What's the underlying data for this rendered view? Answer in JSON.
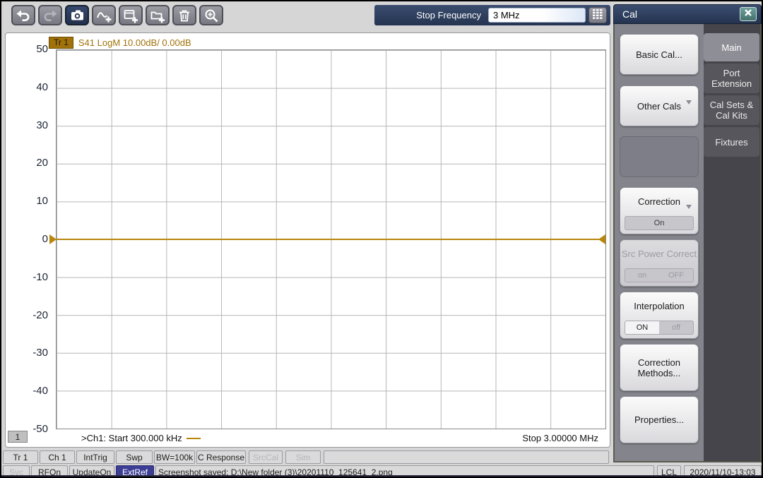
{
  "toolbar": {
    "buttons": [
      {
        "icon": "undo-icon",
        "state": "enabled"
      },
      {
        "icon": "redo-icon",
        "state": "disabled"
      },
      {
        "icon": "camera-icon",
        "state": "active"
      },
      {
        "icon": "add-trace-icon",
        "state": "enabled"
      },
      {
        "icon": "add-channel-icon",
        "state": "enabled"
      },
      {
        "icon": "new-window-icon",
        "state": "enabled"
      },
      {
        "icon": "delete-icon",
        "state": "enabled"
      },
      {
        "icon": "zoom-in-icon",
        "state": "enabled"
      }
    ],
    "stop_frequency": {
      "label": "Stop Frequency",
      "value": "3 MHz",
      "keypad_icon": "keypad-icon"
    }
  },
  "cal_panel": {
    "title": "Cal",
    "close_icon": "close-icon",
    "buttons": {
      "basic_cal": "Basic Cal...",
      "other_cals": "Other Cals",
      "correction": "Correction",
      "correction_state": "On",
      "src_power_correct": "Src Power Correct",
      "src_power_on": "on",
      "src_power_off": "OFF",
      "interpolation": "Interpolation",
      "interpolation_on": "ON",
      "interpolation_off": "off",
      "correction_methods": "Correction Methods...",
      "properties": "Properties..."
    },
    "tabs": [
      {
        "label": "Main",
        "active": true
      },
      {
        "label": "Port Extension",
        "active": false
      },
      {
        "label": "Cal Sets & Cal Kits",
        "active": false
      },
      {
        "label": "Fixtures",
        "active": false
      }
    ]
  },
  "graph": {
    "trace_badge": "Tr 1",
    "trace_info": "S41 LogM 10.00dB/ 0.00dB",
    "y_ticks": [
      "50",
      "40",
      "30",
      "20",
      "10",
      "0",
      "-10",
      "-20",
      "-30",
      "-40",
      "-50"
    ],
    "trace_value_db": 0,
    "start_label": ">Ch1: Start  300.000 kHz",
    "stop_label": "Stop  3.00000 MHz",
    "marker_badge": "1",
    "trace_color": "#b8860b",
    "grid_divisions_x": 10,
    "grid_divisions_y": 10
  },
  "status_row1": [
    "Tr 1",
    "Ch 1",
    "IntTrig",
    "Swp",
    "BW=100k",
    "C  Response",
    "SrcCal",
    "Sim"
  ],
  "status_row2": {
    "svc": "Svc",
    "rf": "RFOn",
    "update": "UpdateOn",
    "extref": "ExtRef",
    "message": "Screenshot saved: D:\\New folder (3)\\20201110_125641_2.png",
    "lcl": "LCL",
    "datetime": "2020/11/10-13:03"
  },
  "colors": {
    "accent_navy": "#2c3d5e",
    "trace_gold": "#b8860b",
    "extref_badge": "#3c3e95"
  }
}
